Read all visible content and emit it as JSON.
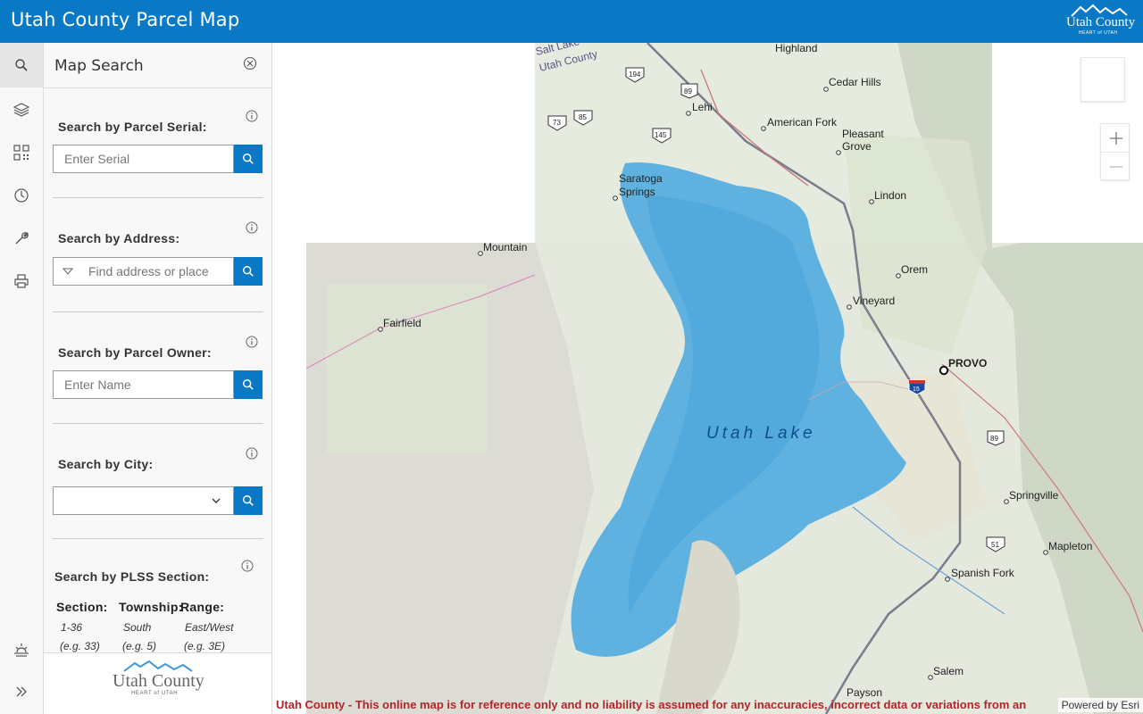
{
  "header": {
    "title": "Utah County Parcel Map",
    "logo_text": "Utah County",
    "logo_sub": "HEART of UTAH"
  },
  "rail": {
    "items": [
      "search-icon",
      "layers-icon",
      "qr-code-icon",
      "clock-icon",
      "wrench-icon",
      "printer-icon"
    ],
    "bottom_items": [
      "sunrise-icon",
      "double-chevron-right-icon"
    ]
  },
  "panel": {
    "title": "Map Search",
    "serial": {
      "label": "Search by Parcel Serial:",
      "placeholder": "Enter Serial"
    },
    "address": {
      "label": "Search by Address:",
      "placeholder": "Find address or place"
    },
    "owner": {
      "label": "Search by Parcel Owner:",
      "placeholder": "Enter Name"
    },
    "city": {
      "label": "Search by City:",
      "value": ""
    },
    "plss": {
      "label": "Search by PLSS Section:",
      "columns": [
        {
          "head": "Section:",
          "sub1": "1-36",
          "sub2": "(e.g. 33)"
        },
        {
          "head": "Township:",
          "sub1": "South",
          "sub2": "(e.g. 5)"
        },
        {
          "head": "Range:",
          "sub1": "East/West",
          "sub2": "(e.g. 3E)"
        }
      ]
    },
    "footer_logo_text": "Utah County",
    "footer_logo_sub": "HEART of UTAH"
  },
  "map": {
    "lake_label": "Utah Lake",
    "places": [
      "Highland",
      "Cedar Hills",
      "Lehi",
      "American Fork",
      "Pleasant",
      "Grove",
      "Saratoga",
      "Springs",
      "Lindon",
      "Mountain",
      "Orem",
      "Fairfield",
      "Vineyard",
      "PROVO",
      "Springville",
      "Mapleton",
      "Spanish Fork",
      "Salem",
      "Payson",
      "Salt Lake",
      "Utah County"
    ],
    "shields": [
      "194",
      "89",
      "73",
      "85",
      "145",
      "15",
      "89",
      "51"
    ],
    "disclaimer": "Utah County - This online map is for reference only and no liability is assumed for any inaccuracies, incorrect data or variations from an",
    "attribution": "Powered by Esri"
  },
  "colors": {
    "header": "#0a79c5",
    "accent": "#0a79c5",
    "disclaimer": "#b0262a",
    "lake": "#5fb2e0"
  }
}
